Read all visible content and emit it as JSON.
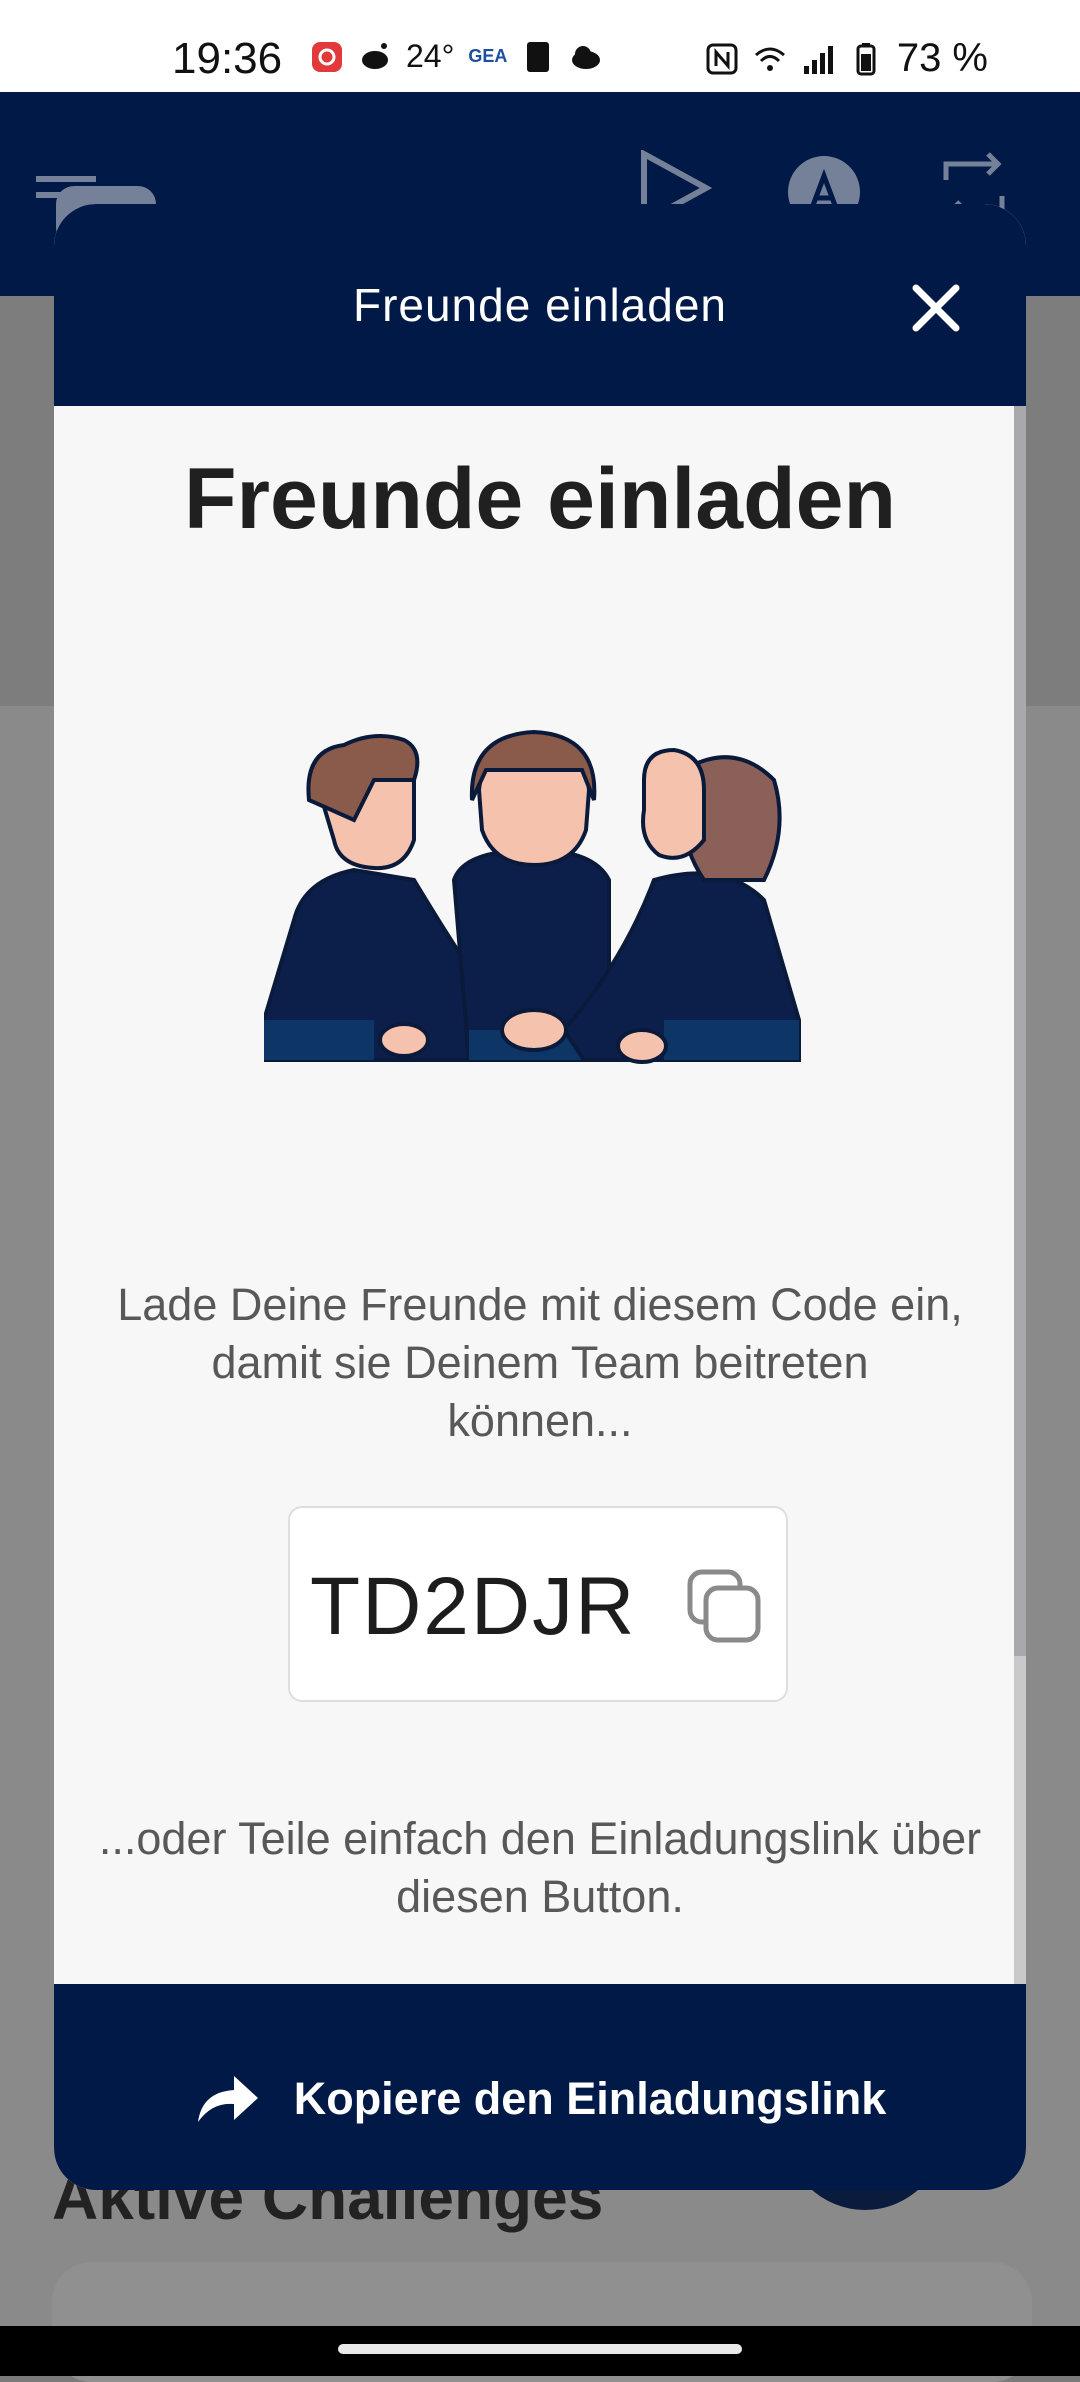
{
  "status_bar": {
    "time": "19:36",
    "temperature": "24°",
    "weather_brand": "GEA",
    "battery": "73 %"
  },
  "modal": {
    "header_title": "Freunde einladen",
    "heading": "Freunde einladen",
    "description": "Lade Deine Freunde mit diesem Code ein, damit sie Deinem Team beitreten können...",
    "invite_code": "TD2DJR",
    "share_hint": "...oder Teile einfach den Einladungslink über diesen Button.",
    "cta_label": "Kopiere den Einladungslink"
  },
  "background": {
    "section_title": "Aktive Challenges"
  },
  "colors": {
    "navy": "#011946",
    "modal_bg": "#f7f7f8",
    "text_grey": "#585858"
  },
  "icons": [
    "close-icon",
    "copy-icon",
    "share-arrow-icon",
    "menu-icon",
    "play-store-icon",
    "app-store-icon",
    "swap-icon"
  ]
}
